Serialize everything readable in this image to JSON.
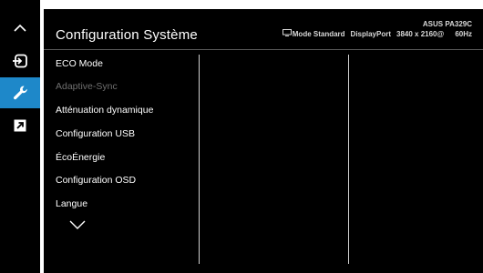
{
  "app": {
    "title": "Configuration Système",
    "model": "ASUS PA329C",
    "mode": "Mode Standard",
    "input": "DisplayPort",
    "resolution": "3840 x 2160@",
    "refresh": "60Hz"
  },
  "rail": {
    "icons": [
      "chevron-up-icon",
      "input-select-icon",
      "wrench-icon",
      "shortcut-icon"
    ],
    "active": "wrench-icon",
    "active_color": "#1e88c9"
  },
  "menu": {
    "items": [
      {
        "label": "ECO Mode",
        "enabled": true
      },
      {
        "label": "Adaptive-Sync",
        "enabled": false
      },
      {
        "label": "Atténuation dynamique",
        "enabled": true
      },
      {
        "label": "Configuration USB",
        "enabled": true
      },
      {
        "label": "ÉcoÉnergie",
        "enabled": true
      },
      {
        "label": "Configuration OSD",
        "enabled": true
      },
      {
        "label": "Langue",
        "enabled": true
      }
    ],
    "more_icon": "chevron-down-icon"
  }
}
